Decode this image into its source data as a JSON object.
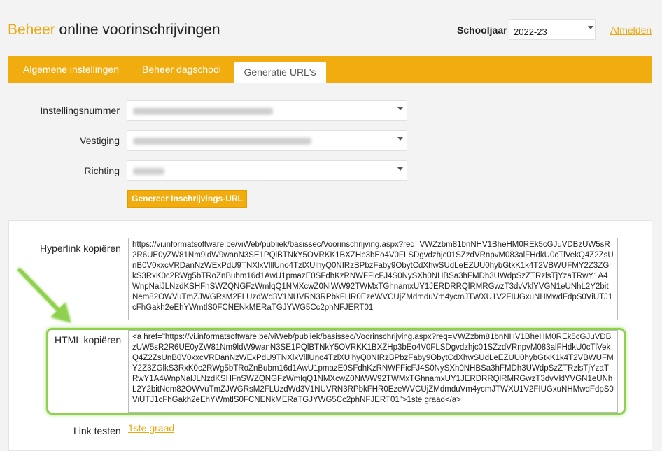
{
  "header": {
    "title_accent": "Beheer",
    "title_rest": " online voorinschrijvingen",
    "schoolyear_label": "Schooljaar",
    "schoolyear_value": "2022-23",
    "logout_label": "Afmelden"
  },
  "tabs": [
    {
      "label": "Algemene instellingen",
      "active": false
    },
    {
      "label": "Beheer dagschool",
      "active": false
    },
    {
      "label": "Generatie URL's",
      "active": true
    }
  ],
  "form": {
    "instellingsnummer_label": "Instellingsnummer",
    "vestiging_label": "Vestiging",
    "richting_label": "Richting",
    "generate_button": "Genereer Inschrijvings-URL"
  },
  "output": {
    "hyperlink_label": "Hyperlink kopiëren",
    "hyperlink_value": "https://vi.informatsoftware.be/viWeb/publiek/basissec/Voorinschrijving.aspx?req=VWZzbm81bnNHV1BheHM0REk5cGJuVDBzUW5sR2R6UE0yZW81Nm9ldW9wanN3SE1PQlBTNkY5OVRKK1BXZHp3bEo4V0FLSDgvdzhjc01SZzdVRnpvM083alFHdkU0cTlVekQ4Z2ZsUnB0V0xxcVRDanNzWExPdU9TNXlxVlllUno4TzlXUlhyQ0NIRzBPbzFaby9ObytCdXhwSUdLeEZUU0hybGtkK1k4T2VBWUFMY2Z3ZGlkS3RxK0c2RWg5bTRoZnBubm16d1AwU1pmazE0SFdhKzRNWFFicFJ4S0NySXh0NHBSa3hFMDh3UWdpSzZTRzlsTjYzaTRwY1A4WnpNalJLNzdKSHFnSWZQNGFzWmlqQ1NMXcwZ0NiWW92TWMxTGhnamxUY1JERDRRQlRMRGwzT3dvVklYVGN1eUNhL2Y2bitNem82OWVuTmZJWGRsM2FLUzdWd3V1NUVRN3RPbkFHR0EzeWVCUjZMdmduVm4ycmJTWXU1V2FIUGxuNHMwdFdpS0ViUTJ1cFhGakh2eEhYWmtlS0FCNENkMERaTGJYWG5Cc2phNFJERT01",
    "html_label": "HTML kopiëren",
    "html_value": "<a href=\"https://vi.informatsoftware.be/viWeb/publiek/basissec/Voorinschrijving.aspx?req=VWZzbm81bnNHV1BheHM0REk5cGJuVDBzUW5sR2R6UE0yZW81Nm9ldW9wanN3SE1PQlBTNkY5OVRKK1BXZHp3bEo4V0FLSDgvdzhjc01SZzdVRnpvM083alFHdkU0cTlVekQ4Z2ZsUnB0V0xxcVRDanNzWExPdU9TNXlxVlllUno4TzlXUlhyQ0NIRzBPbzFaby9ObytCdXhwSUdLeEZUU0hybGtkK1k4T2VBWUFMY2Z3ZGlkS3RxK0c2RWg5bTRoZnBubm16d1AwU1pmazE0SFdhKzRNWFFicFJ4S0NySXh0NHBSa3hFMDh3UWdpSzZTRzlsTjYzaTRwY1A4WnpNalJLNzdKSHFnSWZQNGFzWmlqQ1NMXcwZ0NiWW92TWMxTGhnamxUY1JERDRRQlRMRGwzT3dvVklYVGN1eUNhL2Y2bitNem82OWVuTmZJWGRsM2FLUzdWd3V1NUVRN3RPbkFHR0EzeWVCUjZMdmduVm4ycmJTWXU1V2FIUGxuNHMwdFdpS0ViUTJ1cFhGakh2eEhYWmtlS0FCNENkMERaTGJYWG5Cc2phNFJERT01\">1ste graad</a>",
    "test_label": "Link testen",
    "test_link": "1ste graad"
  },
  "colors": {
    "accent": "#f1ad0f",
    "highlight": "#8fd14f"
  }
}
